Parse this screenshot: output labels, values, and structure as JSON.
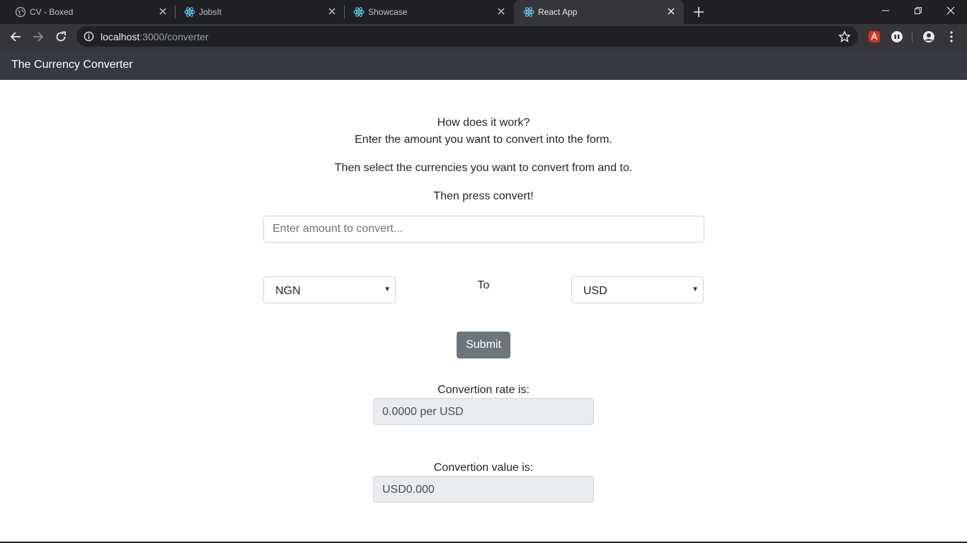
{
  "browser": {
    "tabs": [
      {
        "title": "CV - Boxed",
        "icon": "globe-icon"
      },
      {
        "title": "JobsIt",
        "icon": "react-icon"
      },
      {
        "title": "Showcase",
        "icon": "react-icon"
      },
      {
        "title": "React App",
        "icon": "react-icon",
        "active": true
      }
    ],
    "url_host": "localhost",
    "url_path": ":3000/converter"
  },
  "app": {
    "brand": "The Currency Converter"
  },
  "instructions": {
    "line1": "How does it work?",
    "line2": "Enter the amount you want to convert into the form.",
    "line3": "Then select the currencies you want to convert from and to.",
    "line4": "Then press convert!"
  },
  "form": {
    "amount_placeholder": "Enter amount to convert...",
    "from_currency": "NGN",
    "to_label": "To",
    "to_currency": "USD",
    "submit_label": "Submit"
  },
  "results": {
    "rate_label": "Convertion rate is:",
    "rate_value": "0.0000 per USD",
    "value_label": "Convertion value is:",
    "value_value": "USD0.000"
  },
  "colors": {
    "navbar": "#343a40",
    "button": "#6c757d",
    "readonly_bg": "#e9ecef"
  }
}
